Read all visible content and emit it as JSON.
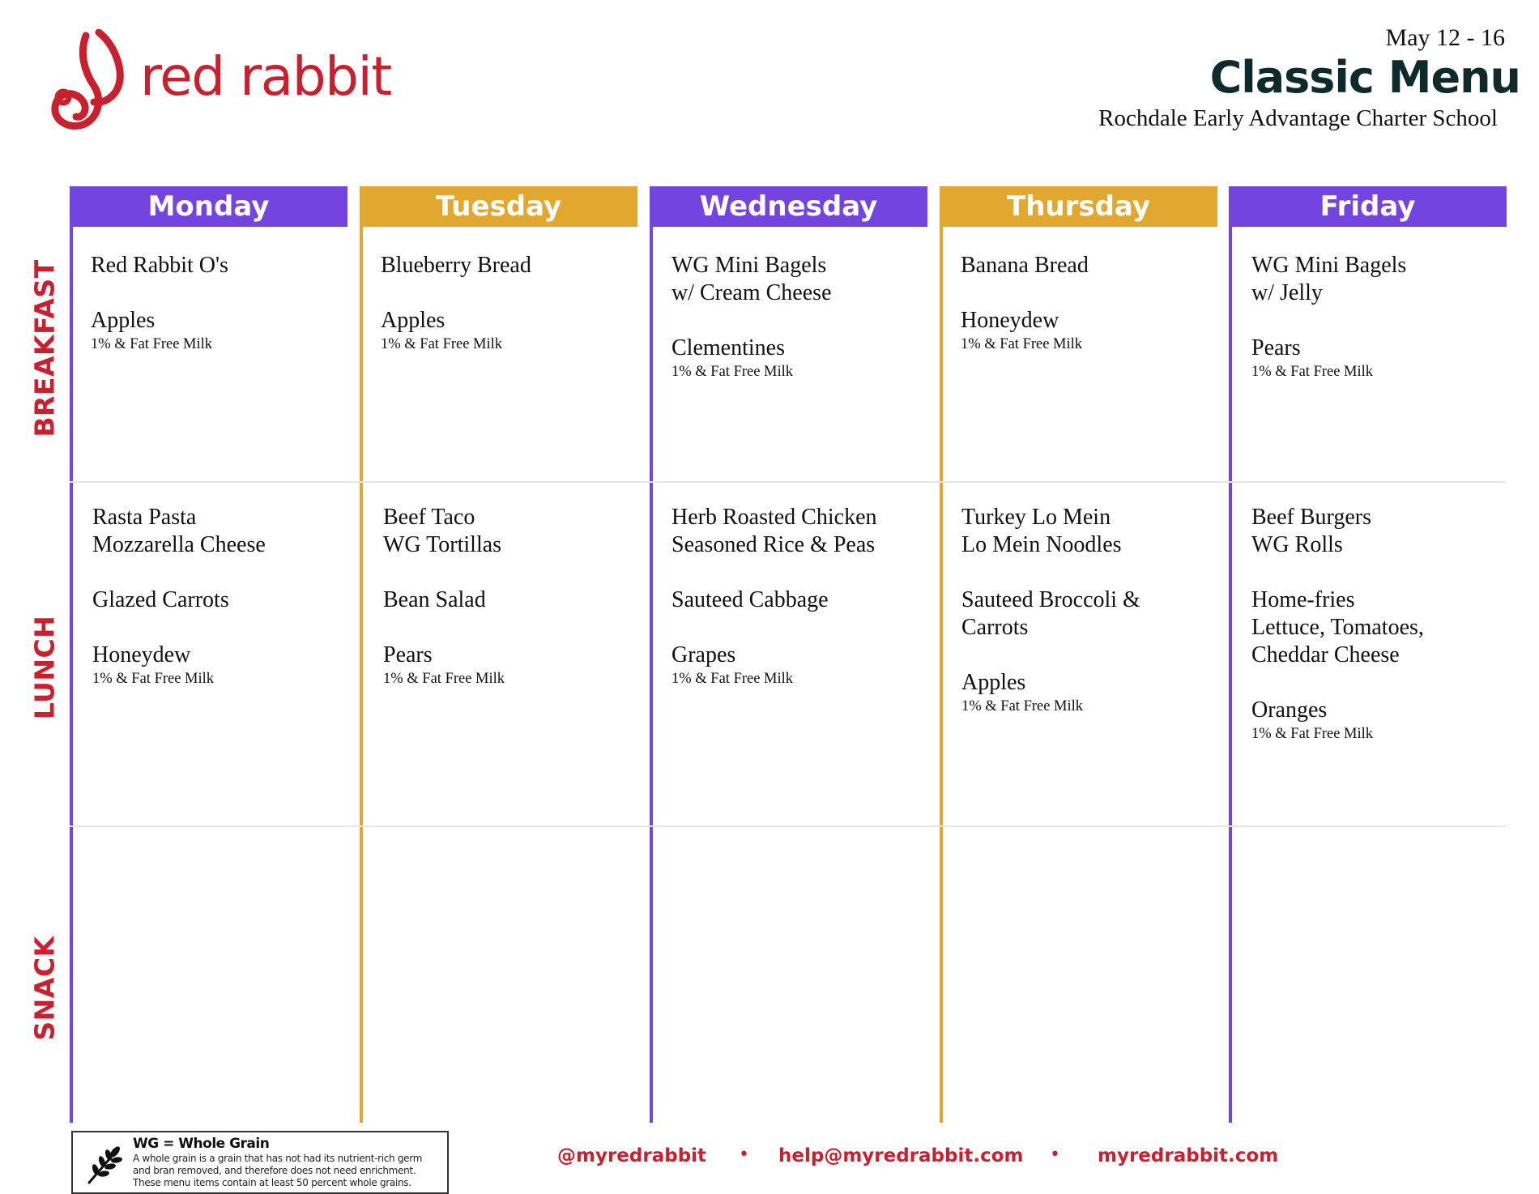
{
  "brand": {
    "name": "red rabbit",
    "logo_icon": "rabbit-logo-icon",
    "color": "#c8202f"
  },
  "header": {
    "date_range": "May 12 - 16",
    "title": "Classic Menu",
    "school": "Rochdale Early Advantage Charter School"
  },
  "colors": {
    "purple": "#7444e0",
    "gold": "#e2a72f",
    "label_red": "#c8202f"
  },
  "meal_labels": [
    "BREAKFAST",
    "LUNCH",
    "SNACK"
  ],
  "days": [
    {
      "name": "Monday",
      "breakfast": {
        "items": [
          "Red Rabbit O's",
          "Apples"
        ],
        "milk": "1% & Fat Free Milk"
      },
      "lunch": {
        "items": [
          "Rasta Pasta\nMozzarella Cheese",
          "Glazed Carrots",
          "Honeydew"
        ],
        "milk": "1% & Fat Free Milk"
      }
    },
    {
      "name": "Tuesday",
      "breakfast": {
        "items": [
          "Blueberry Bread",
          "Apples"
        ],
        "milk": "1% & Fat Free Milk"
      },
      "lunch": {
        "items": [
          "Beef Taco\nWG Tortillas",
          "Bean Salad",
          "Pears"
        ],
        "milk": "1% & Fat Free Milk"
      }
    },
    {
      "name": "Wednesday",
      "breakfast": {
        "items": [
          "WG Mini Bagels\nw/ Cream Cheese",
          "Clementines"
        ],
        "milk": "1% & Fat Free Milk"
      },
      "lunch": {
        "items": [
          "Herb Roasted Chicken\nSeasoned Rice & Peas",
          "Sauteed Cabbage",
          "Grapes"
        ],
        "milk": "1% & Fat Free Milk"
      }
    },
    {
      "name": "Thursday",
      "breakfast": {
        "items": [
          "Banana Bread",
          "Honeydew"
        ],
        "milk": "1% & Fat Free Milk"
      },
      "lunch": {
        "items": [
          "Turkey Lo Mein\nLo Mein Noodles",
          "Sauteed Broccoli &\nCarrots",
          "Apples"
        ],
        "milk": "1% & Fat Free Milk"
      }
    },
    {
      "name": "Friday",
      "breakfast": {
        "items": [
          "WG Mini Bagels\nw/ Jelly",
          "Pears"
        ],
        "milk": "1% & Fat Free Milk"
      },
      "lunch": {
        "items": [
          "Beef Burgers\nWG Rolls",
          "Home-fries\nLettuce, Tomatoes,\nCheddar Cheese",
          "Oranges"
        ],
        "milk": "1% & Fat Free Milk"
      }
    }
  ],
  "legend": {
    "icon": "wheat-icon",
    "title": "WG = Whole Grain",
    "description": "A whole grain is a grain that has not had its nutrient-rich germ and bran removed, and therefore does not need enrichment. These menu items contain at least 50 percent whole grains."
  },
  "footer": {
    "social": "@myredrabbit",
    "email": "help@myredrabbit.com",
    "website": "myredrabbit.com",
    "separator": "•"
  }
}
